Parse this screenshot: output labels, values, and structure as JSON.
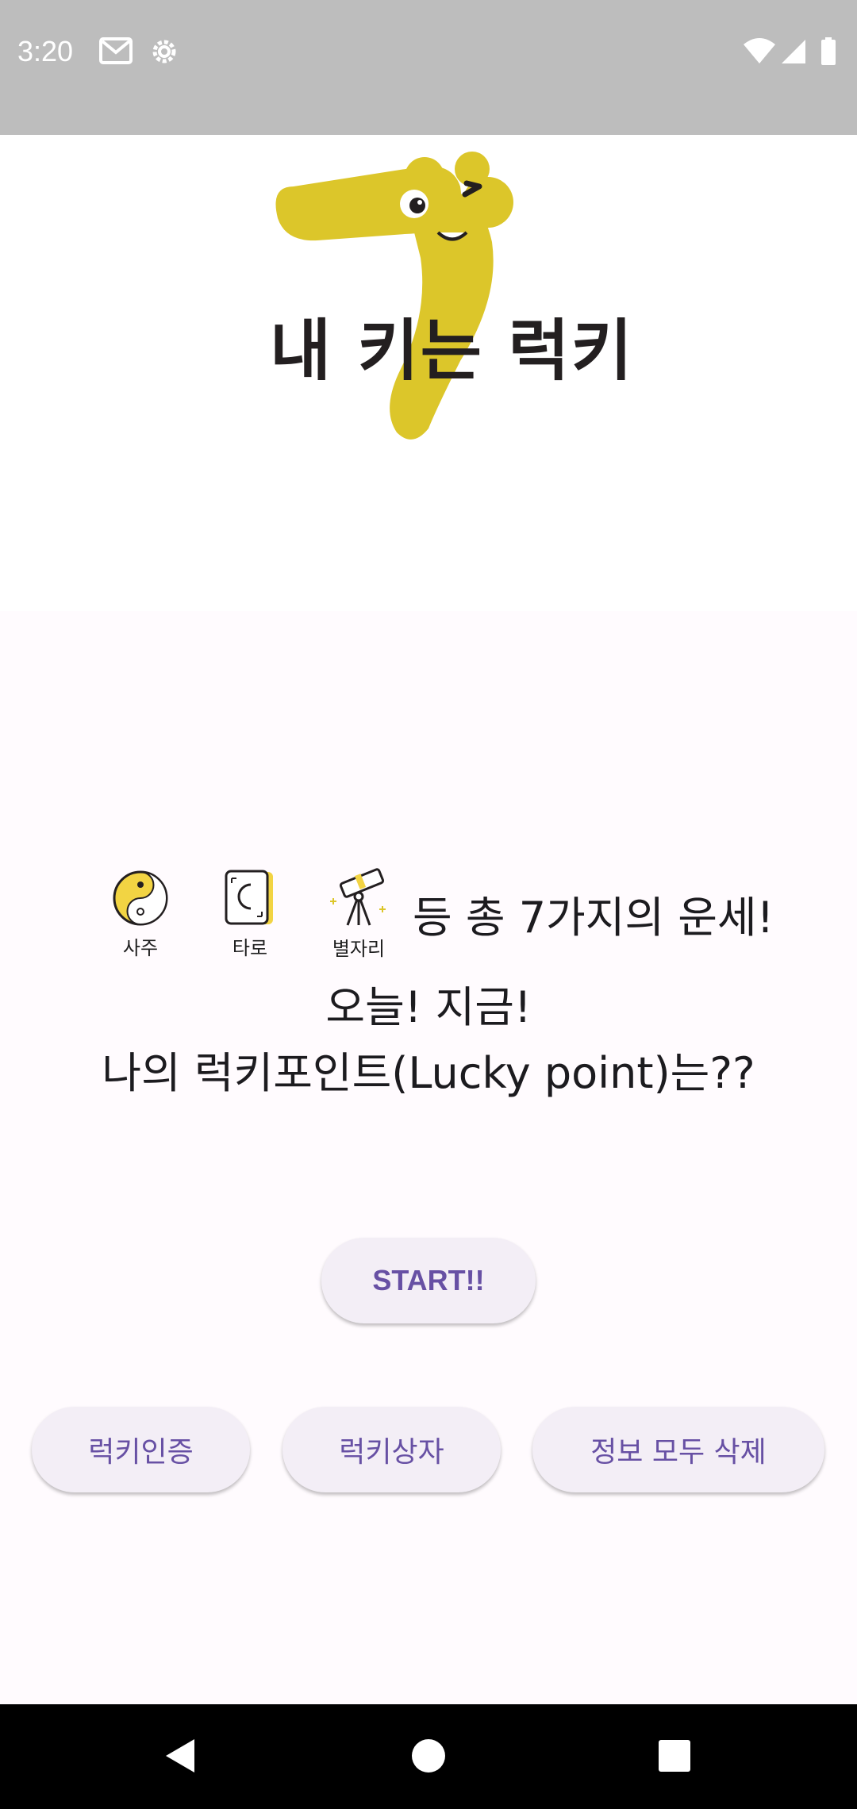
{
  "status_bar": {
    "time": "3:20",
    "left_icons": [
      "gmail-icon",
      "settings-icon"
    ],
    "right_icons": [
      "wifi-icon",
      "signal-icon",
      "battery-icon"
    ]
  },
  "logo": {
    "text": "내 키는 럭키",
    "brand_color": "#dcc62a"
  },
  "fortune_types": [
    {
      "label": "사주",
      "icon": "yin-yang-icon"
    },
    {
      "label": "타로",
      "icon": "tarot-card-icon"
    },
    {
      "label": "별자리",
      "icon": "telescope-icon"
    }
  ],
  "headline": {
    "line1": "등 총 7가지의 운세!",
    "line2": "오늘! 지금!",
    "line3": "나의 럭키포인트(Lucky point)는??"
  },
  "buttons": {
    "start": "START!!",
    "lucky_verify": "럭키인증",
    "lucky_box": "럭키상자",
    "delete_all": "정보 모두 삭제"
  },
  "colors": {
    "accent": "#6750a4",
    "button_bg": "#f3eef6",
    "background": "#fffbfe"
  }
}
